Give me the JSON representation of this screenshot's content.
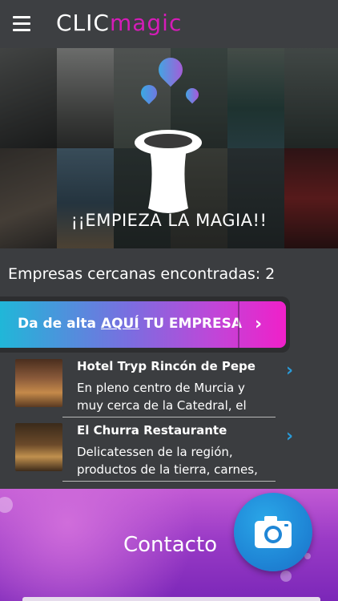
{
  "header": {
    "brand_part1": "CLIC",
    "brand_part2": "magic",
    "menu_icon": "hamburger-icon"
  },
  "hero": {
    "title": "¡¡EMPIEZA LA MAGIA!!",
    "icon": "magic-hat-icon"
  },
  "found": {
    "text": "Empresas cercanas encontradas: 2"
  },
  "cta": {
    "text_part1": "Da de alta ",
    "text_part2": "AQUÍ",
    "text_part3": " TU EMPRESA",
    "arrow": "›"
  },
  "businesses": [
    {
      "name": "Hotel Tryp Rincón de Pepe",
      "desc_line1": "En pleno centro de Murcia y",
      "desc_line2": "muy cerca de la Catedral, el",
      "chevron": "›"
    },
    {
      "name": "El Churra Restaurante",
      "desc_line1": "Delicatessen de la región,",
      "desc_line2": "productos de la tierra, carnes,",
      "chevron": "›"
    }
  ],
  "contact": {
    "label": "Contacto",
    "camera_icon": "camera-icon"
  },
  "colors": {
    "accent_blue": "#2a9bd8",
    "brand_magenta": "#d51cb8",
    "contact_purple": "#9a3bc6"
  }
}
